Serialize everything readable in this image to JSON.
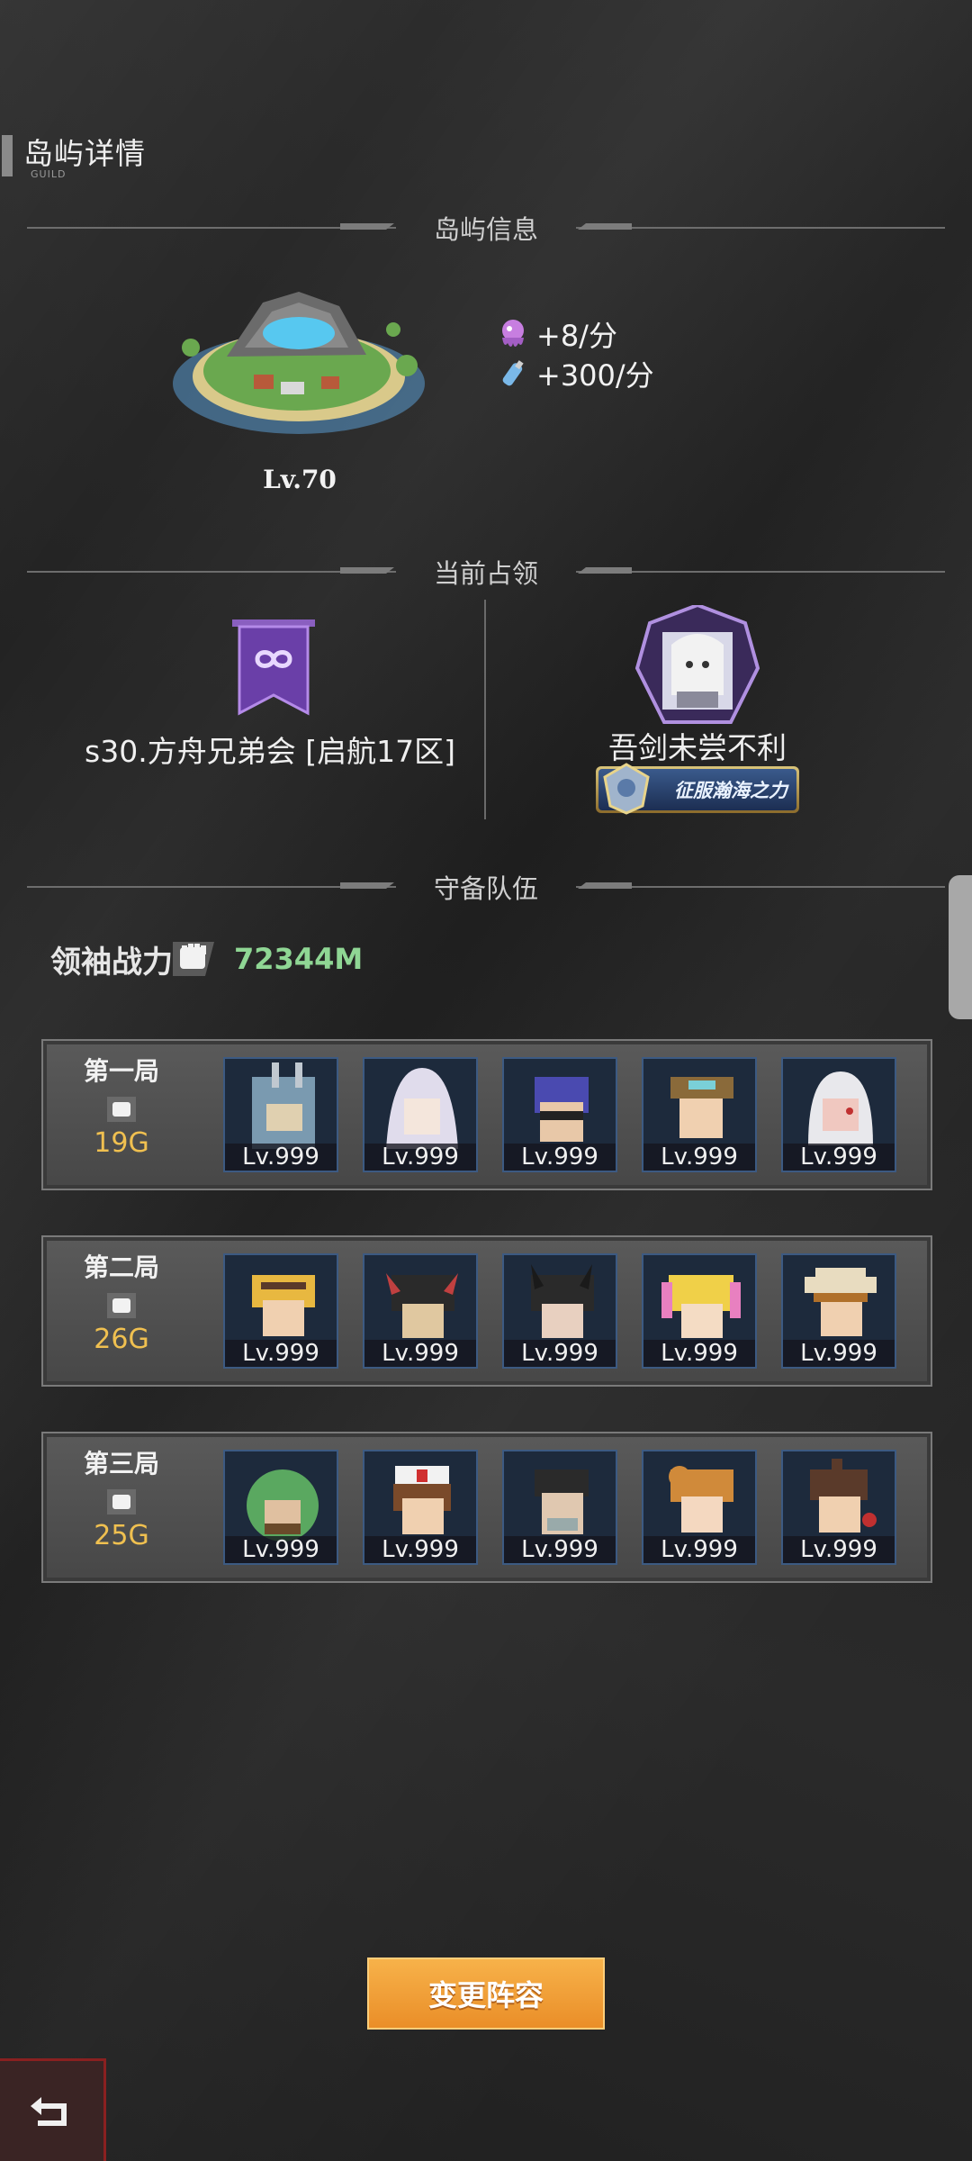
{
  "header": {
    "title": "岛屿详情",
    "subtitle": "GUILD"
  },
  "sections": {
    "island_info": "岛屿信息",
    "current_occupation": "当前占领",
    "defense_team": "守备队伍"
  },
  "island": {
    "level": "Lv.70",
    "resources": [
      {
        "icon": "purple-octopus-icon",
        "text": "+8/分"
      },
      {
        "icon": "bottle-icon",
        "text": "+300/分"
      }
    ]
  },
  "occupation": {
    "guild_name": "s30.方舟兄弟会 [启航17区]",
    "player_name": "吾剑未尝不利",
    "player_title": "征服瀚海之力"
  },
  "leader": {
    "label": "领袖战力",
    "power": "72344M"
  },
  "rounds": [
    {
      "name": "第一局",
      "power": "19G",
      "heroes": [
        "Lv.999",
        "Lv.999",
        "Lv.999",
        "Lv.999",
        "Lv.999"
      ]
    },
    {
      "name": "第二局",
      "power": "26G",
      "heroes": [
        "Lv.999",
        "Lv.999",
        "Lv.999",
        "Lv.999",
        "Lv.999"
      ]
    },
    {
      "name": "第三局",
      "power": "25G",
      "heroes": [
        "Lv.999",
        "Lv.999",
        "Lv.999",
        "Lv.999",
        "Lv.999"
      ]
    }
  ],
  "actions": {
    "change_lineup": "变更阵容"
  },
  "colors": {
    "accent": "#f0c050",
    "power_green": "#8fd694",
    "button": "#ea8e28"
  }
}
